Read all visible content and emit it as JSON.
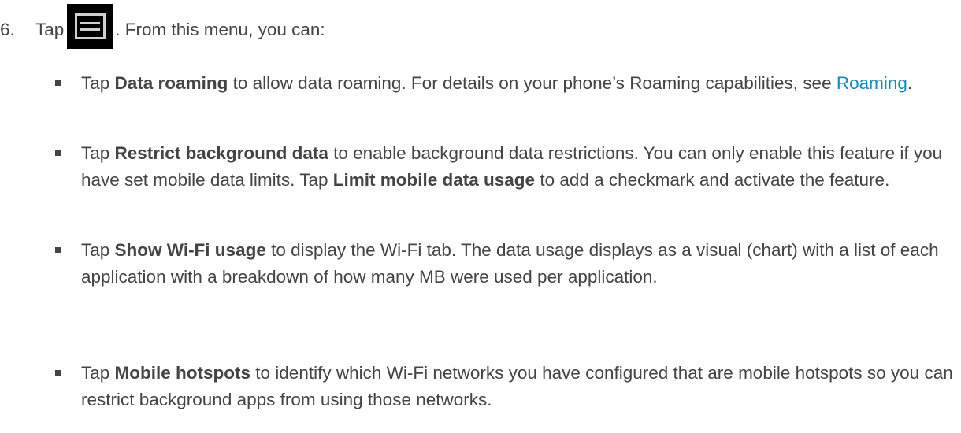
{
  "step": {
    "number": "6.",
    "tap_word": "Tap",
    "after_icon": ". From this menu, you can:",
    "icon": "menu-icon"
  },
  "bullets": [
    {
      "pre": "Tap ",
      "bold": "Data roaming",
      "post": " to allow data roaming. For details on your phone’s Roaming capabilities, see ",
      "link": "Roaming",
      "tail": "."
    },
    {
      "pre": "Tap ",
      "bold": "Restrict background data",
      "post": " to enable background data restrictions. You can only enable this feature if you have set mobile data limits. Tap ",
      "bold2": "Limit mobile data usage",
      "tail": " to add a checkmark and activate the feature."
    },
    {
      "pre": "Tap ",
      "bold": "Show Wi-Fi usage",
      "post": " to display the Wi-Fi tab. The data usage displays as a visual (chart) with a list of each application with a breakdown of how many MB were used per application."
    },
    {
      "pre": "Tap ",
      "bold": "Mobile hotspots",
      "post": " to identify which Wi-Fi networks you have configured that are mobile hotspots so you can restrict background apps from using those networks."
    }
  ],
  "colors": {
    "text": "#444444",
    "link": "#1a8ab5",
    "icon_bg": "#000000",
    "icon_fg": "#cfcfcf"
  }
}
